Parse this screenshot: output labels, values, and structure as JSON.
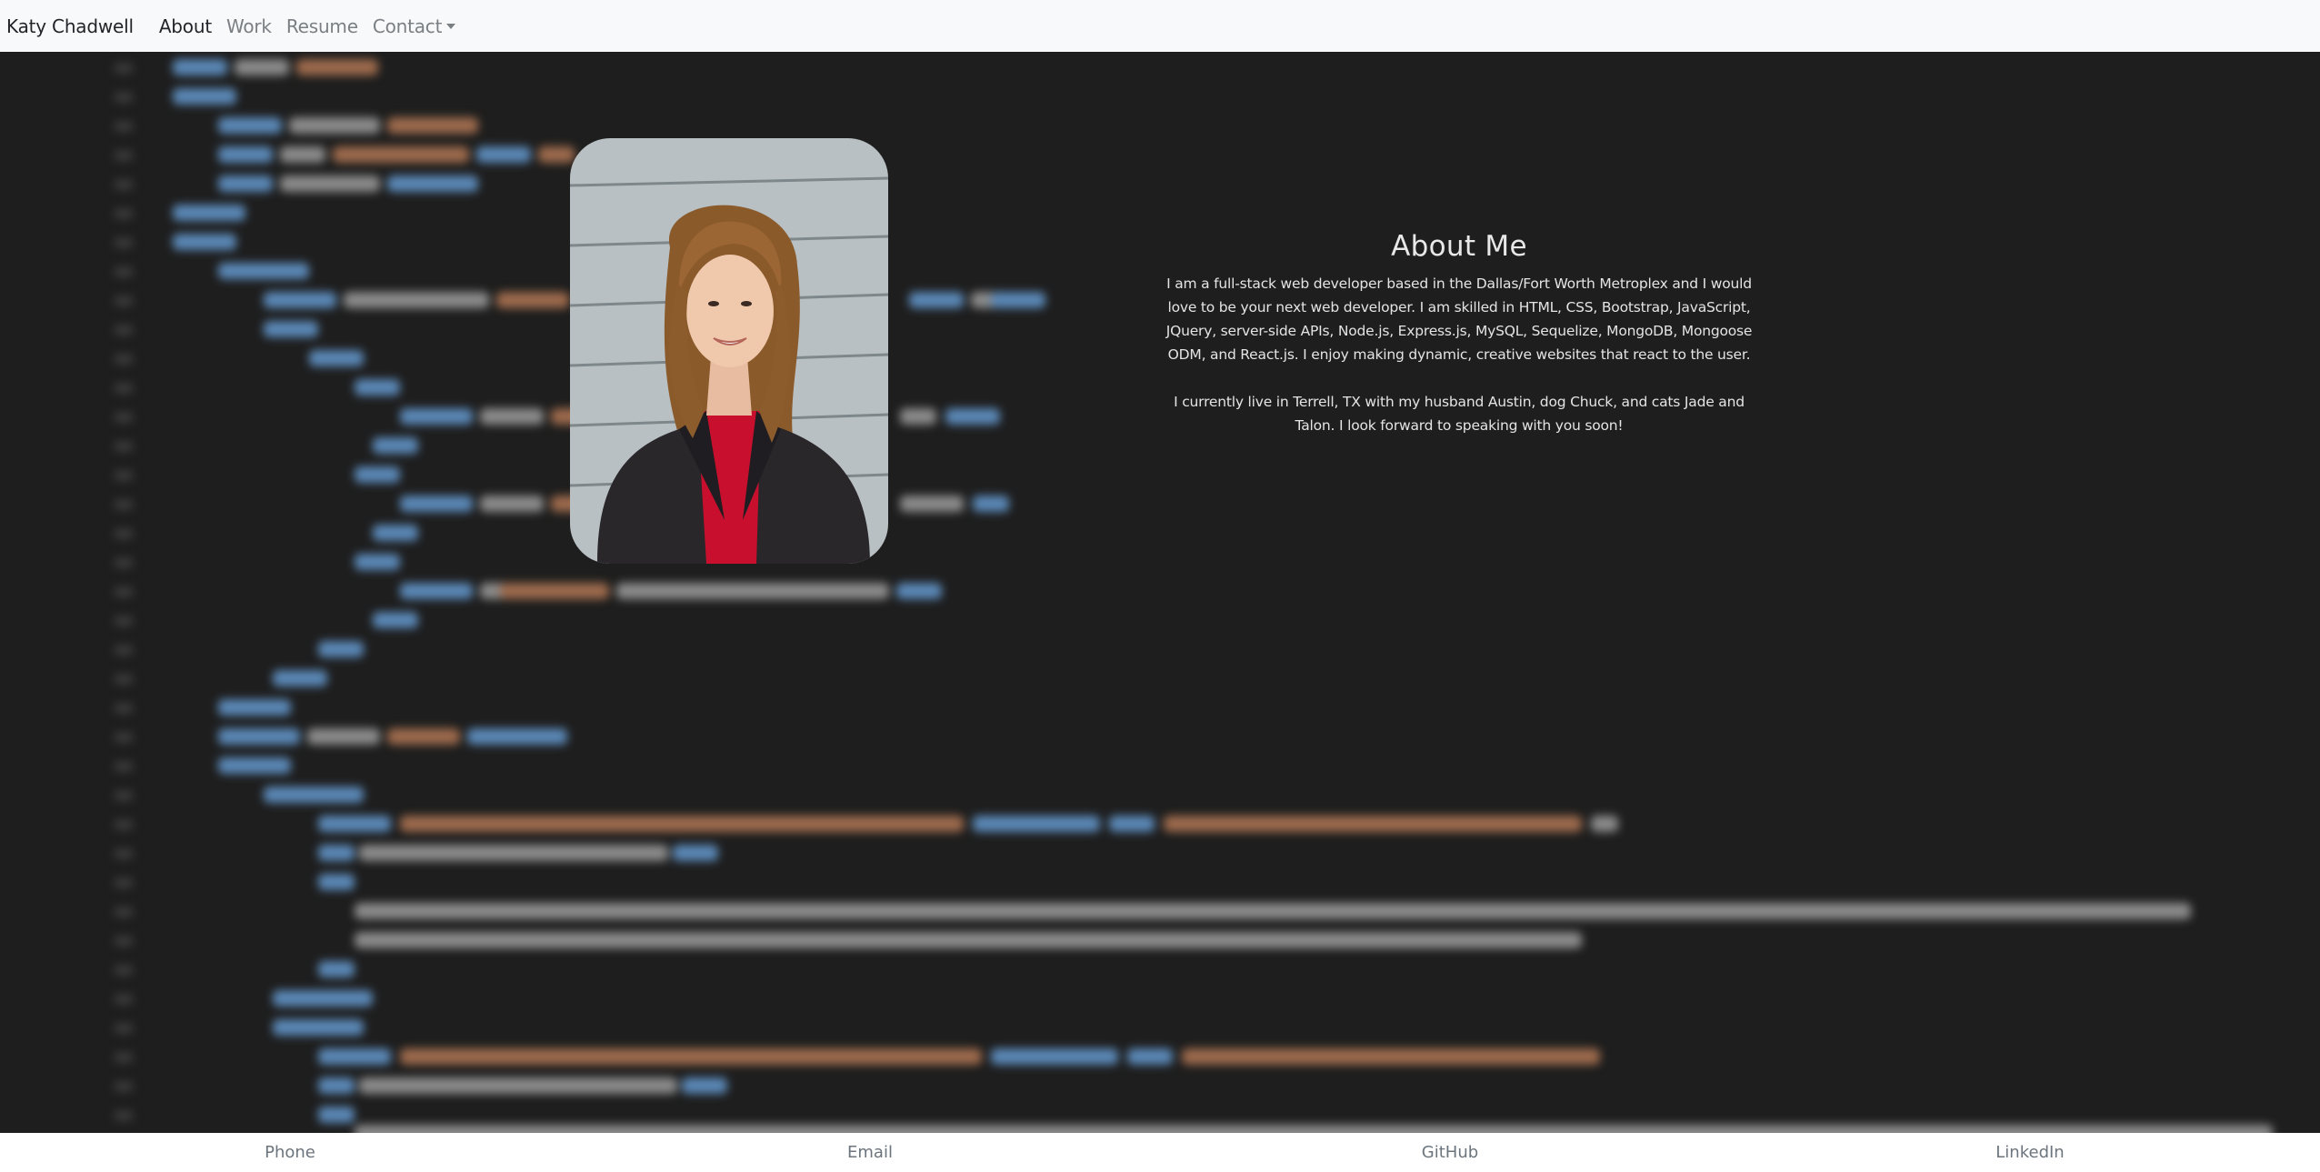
{
  "navbar": {
    "brand": "Katy Chadwell",
    "links": [
      {
        "label": "About"
      },
      {
        "label": "Work"
      },
      {
        "label": "Resume"
      },
      {
        "label": "Contact"
      }
    ]
  },
  "about": {
    "heading": "About Me",
    "paragraph_1": "I am a full-stack web developer based in the Dallas/Fort Worth Metroplex and I would love to be your next web developer. I am skilled in HTML, CSS, Bootstrap, JavaScript, JQuery, server-side APIs, Node.js, Express.js, MySQL, Sequelize, MongoDB, Mongoose ODM, and React.js. I enjoy making dynamic, creative websites that react to the user.",
    "paragraph_2": "I currently live in Terrell, TX with my husband Austin, dog Chuck, and cats Jade and Talon. I look forward to speaking with you soon!"
  },
  "footer": {
    "links": [
      {
        "label": "Phone"
      },
      {
        "label": "Email"
      },
      {
        "label": "GitHub"
      },
      {
        "label": "LinkedIn"
      }
    ]
  },
  "colors": {
    "page_background": "#1e1e1e",
    "navbar_background": "#f8f9fa",
    "footer_background": "#ffffff",
    "text_light": "#e4e4e4"
  }
}
